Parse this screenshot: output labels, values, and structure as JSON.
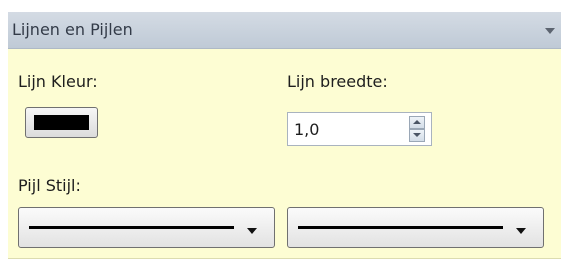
{
  "panel": {
    "title": "Lijnen en Pijlen",
    "line_color_label": "Lijn Kleur:",
    "line_color_value": "#000000",
    "line_width_label": "Lijn breedte:",
    "line_width_value": "1,0",
    "arrow_style_label": "Pijl Stijl:",
    "arrow_start_style": "solid-line",
    "arrow_end_style": "solid-line"
  },
  "icons": {
    "collapse": "chevron-down-icon",
    "spin_up": "spin-up-icon",
    "spin_down": "spin-down-icon",
    "dropdown": "dropdown-arrow-icon"
  },
  "colors": {
    "panel_background": "#fdfdd3",
    "header_background": "#c9d2dd",
    "swatch": "#000000"
  }
}
